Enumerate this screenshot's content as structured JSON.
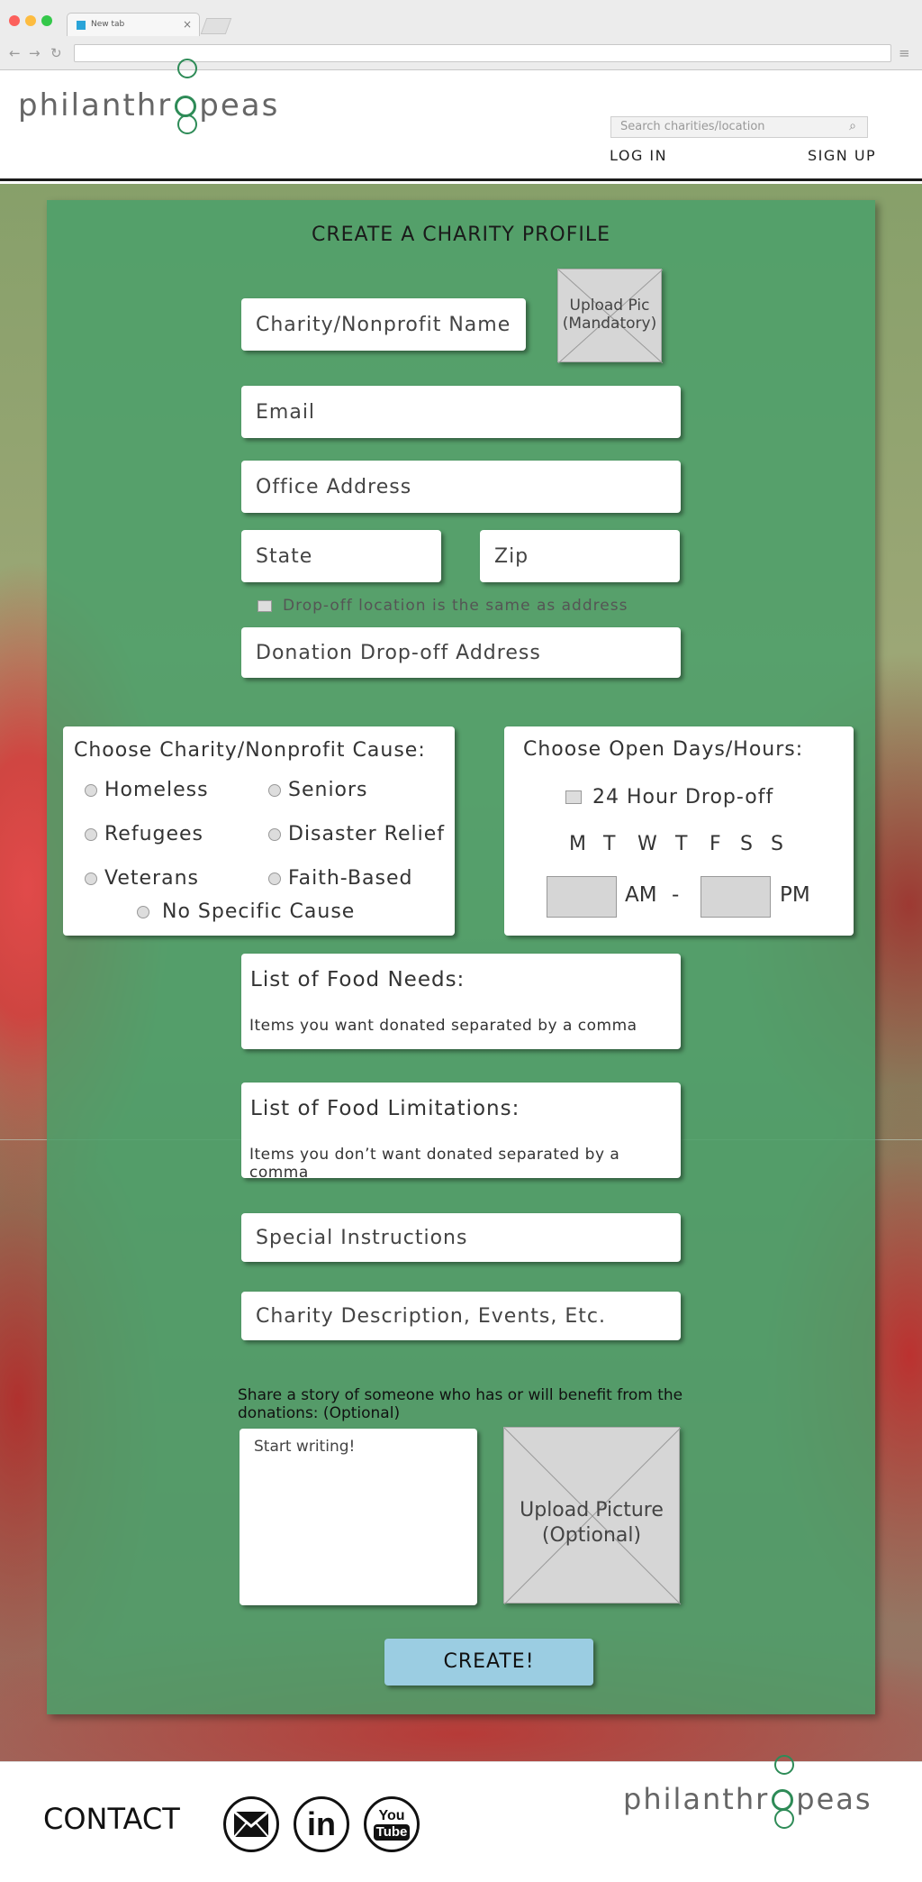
{
  "browser": {
    "tab_title": "New tab",
    "tab_close": "×"
  },
  "header": {
    "logo_left": "philanthr",
    "logo_right": "peas",
    "search_placeholder": "Search charities/location",
    "login_label": "LOG IN",
    "signup_label": "SIGN UP"
  },
  "form": {
    "title": "CREATE A CHARITY PROFILE",
    "name_placeholder": "Charity/Nonprofit Name",
    "upload_pic_line1": "Upload Pic",
    "upload_pic_line2": "(Mandatory)",
    "email_placeholder": "Email",
    "address_placeholder": "Office Address",
    "state_placeholder": "State",
    "zip_placeholder": "Zip",
    "dropoff_same_label": "Drop-off location is the same as address",
    "dropoff_address_placeholder": "Donation Drop-off Address",
    "cause": {
      "title": "Choose Charity/Nonprofit Cause:",
      "options": [
        "Homeless",
        "Seniors",
        "Refugees",
        "Disaster Relief",
        "Veterans",
        "Faith-Based",
        "No Specific Cause"
      ]
    },
    "hours": {
      "title": "Choose Open Days/Hours:",
      "allday_label": "24 Hour Drop-off",
      "days": [
        "M",
        "T",
        "W",
        "T",
        "F",
        "S",
        "S"
      ],
      "am_label": "AM",
      "dash": "-",
      "pm_label": "PM"
    },
    "food_needs": {
      "title": "List of Food Needs:",
      "hint": "Items you want donated separated by a comma"
    },
    "food_limits": {
      "title": "List of Food Limitations:",
      "hint": "Items you don’t want donated separated by a comma"
    },
    "special_placeholder": "Special Instructions",
    "description_placeholder": "Charity Description, Events, Etc.",
    "story_label": "Share a story of someone who has or will benefit from the donations: (Optional)",
    "story_placeholder": "Start writing!",
    "upload_picture_line1": "Upload Picture",
    "upload_picture_line2": "(Optional)",
    "create_label": "CREATE!"
  },
  "footer": {
    "contact_label": "CONTACT",
    "social": [
      "mail-icon",
      "linkedin-icon",
      "youtube-icon"
    ],
    "linkedin_text": "in",
    "youtube_text_1": "You",
    "youtube_text_2": "Tube",
    "logo_left": "philanthr",
    "logo_right": "peas"
  },
  "colors": {
    "accent": "#2e8b57",
    "panel": "#4ca06a",
    "create_button": "#9bcde2"
  }
}
